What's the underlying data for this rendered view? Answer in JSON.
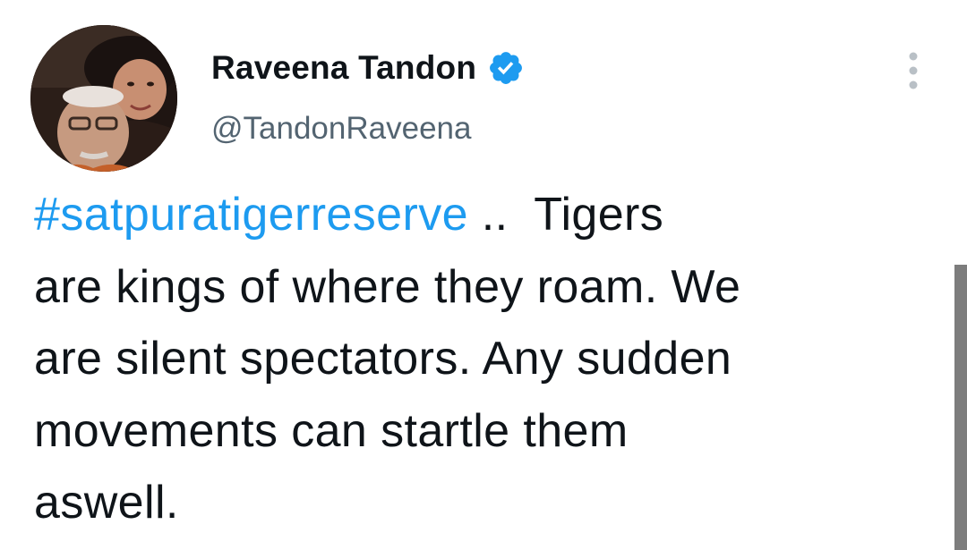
{
  "author": {
    "display_name": "Raveena Tandon",
    "handle": "@TandonRaveena",
    "verified": true,
    "avatar_icon": "profile-photo"
  },
  "tweet": {
    "hashtag": "#satpuratigerreserve",
    "text_line1_rest": " ..  Tigers",
    "text_line2": "are kings of where they roam. We",
    "text_line3": "are silent spectators. Any sudden",
    "text_line4": "movements can startle them",
    "text_line5": "aswell."
  },
  "colors": {
    "accent": "#1d9bf0",
    "text": "#0f1419",
    "secondary_text": "#536471",
    "scrollbar": "#7d7d7d"
  },
  "icons": {
    "verified": "verified-badge-icon",
    "more": "more-options-icon"
  }
}
